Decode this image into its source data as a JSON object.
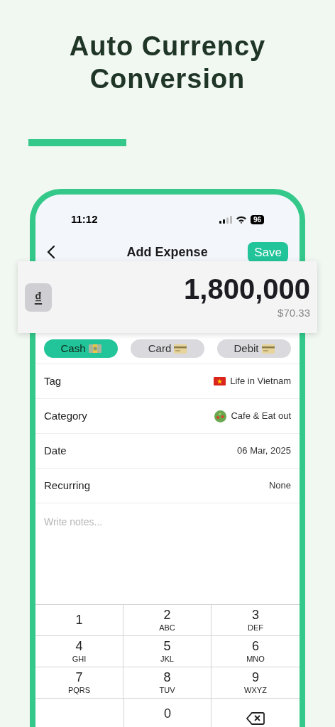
{
  "headline": [
    "Auto Currency",
    "Conversion"
  ],
  "status_bar": {
    "time": "11:12",
    "battery": "96"
  },
  "header": {
    "title": "Add Expense",
    "save": "Save"
  },
  "amount": {
    "currency": "₫",
    "value": "1,800,000",
    "converted": "$70.33"
  },
  "payment_methods": [
    {
      "label": "Cash",
      "kind": "cash",
      "selected": true
    },
    {
      "label": "Card",
      "kind": "card",
      "selected": false
    },
    {
      "label": "Debit",
      "kind": "card",
      "selected": false
    }
  ],
  "fields": [
    {
      "label": "Tag",
      "value": "Life in Vietnam",
      "kind": "flag"
    },
    {
      "label": "Category",
      "value": "Cafe & Eat out",
      "kind": "bowl"
    },
    {
      "label": "Date",
      "value": "06 Mar, 2025"
    },
    {
      "label": "Recurring",
      "value": "None"
    }
  ],
  "notes": {
    "placeholder": "Write notes..."
  },
  "keypad": [
    {
      "digit": "1"
    },
    {
      "digit": "2",
      "letters": "ABC"
    },
    {
      "digit": "3",
      "letters": "DEF"
    },
    {
      "digit": "4",
      "letters": "GHI"
    },
    {
      "digit": "5",
      "letters": "JKL"
    },
    {
      "digit": "6",
      "letters": "MNO"
    },
    {
      "digit": "7",
      "letters": "PQRS"
    },
    {
      "digit": "8",
      "letters": "TUV"
    },
    {
      "digit": "9",
      "letters": "WXYZ"
    },
    {
      "digit": "0"
    },
    {
      "kind": "delete"
    }
  ]
}
